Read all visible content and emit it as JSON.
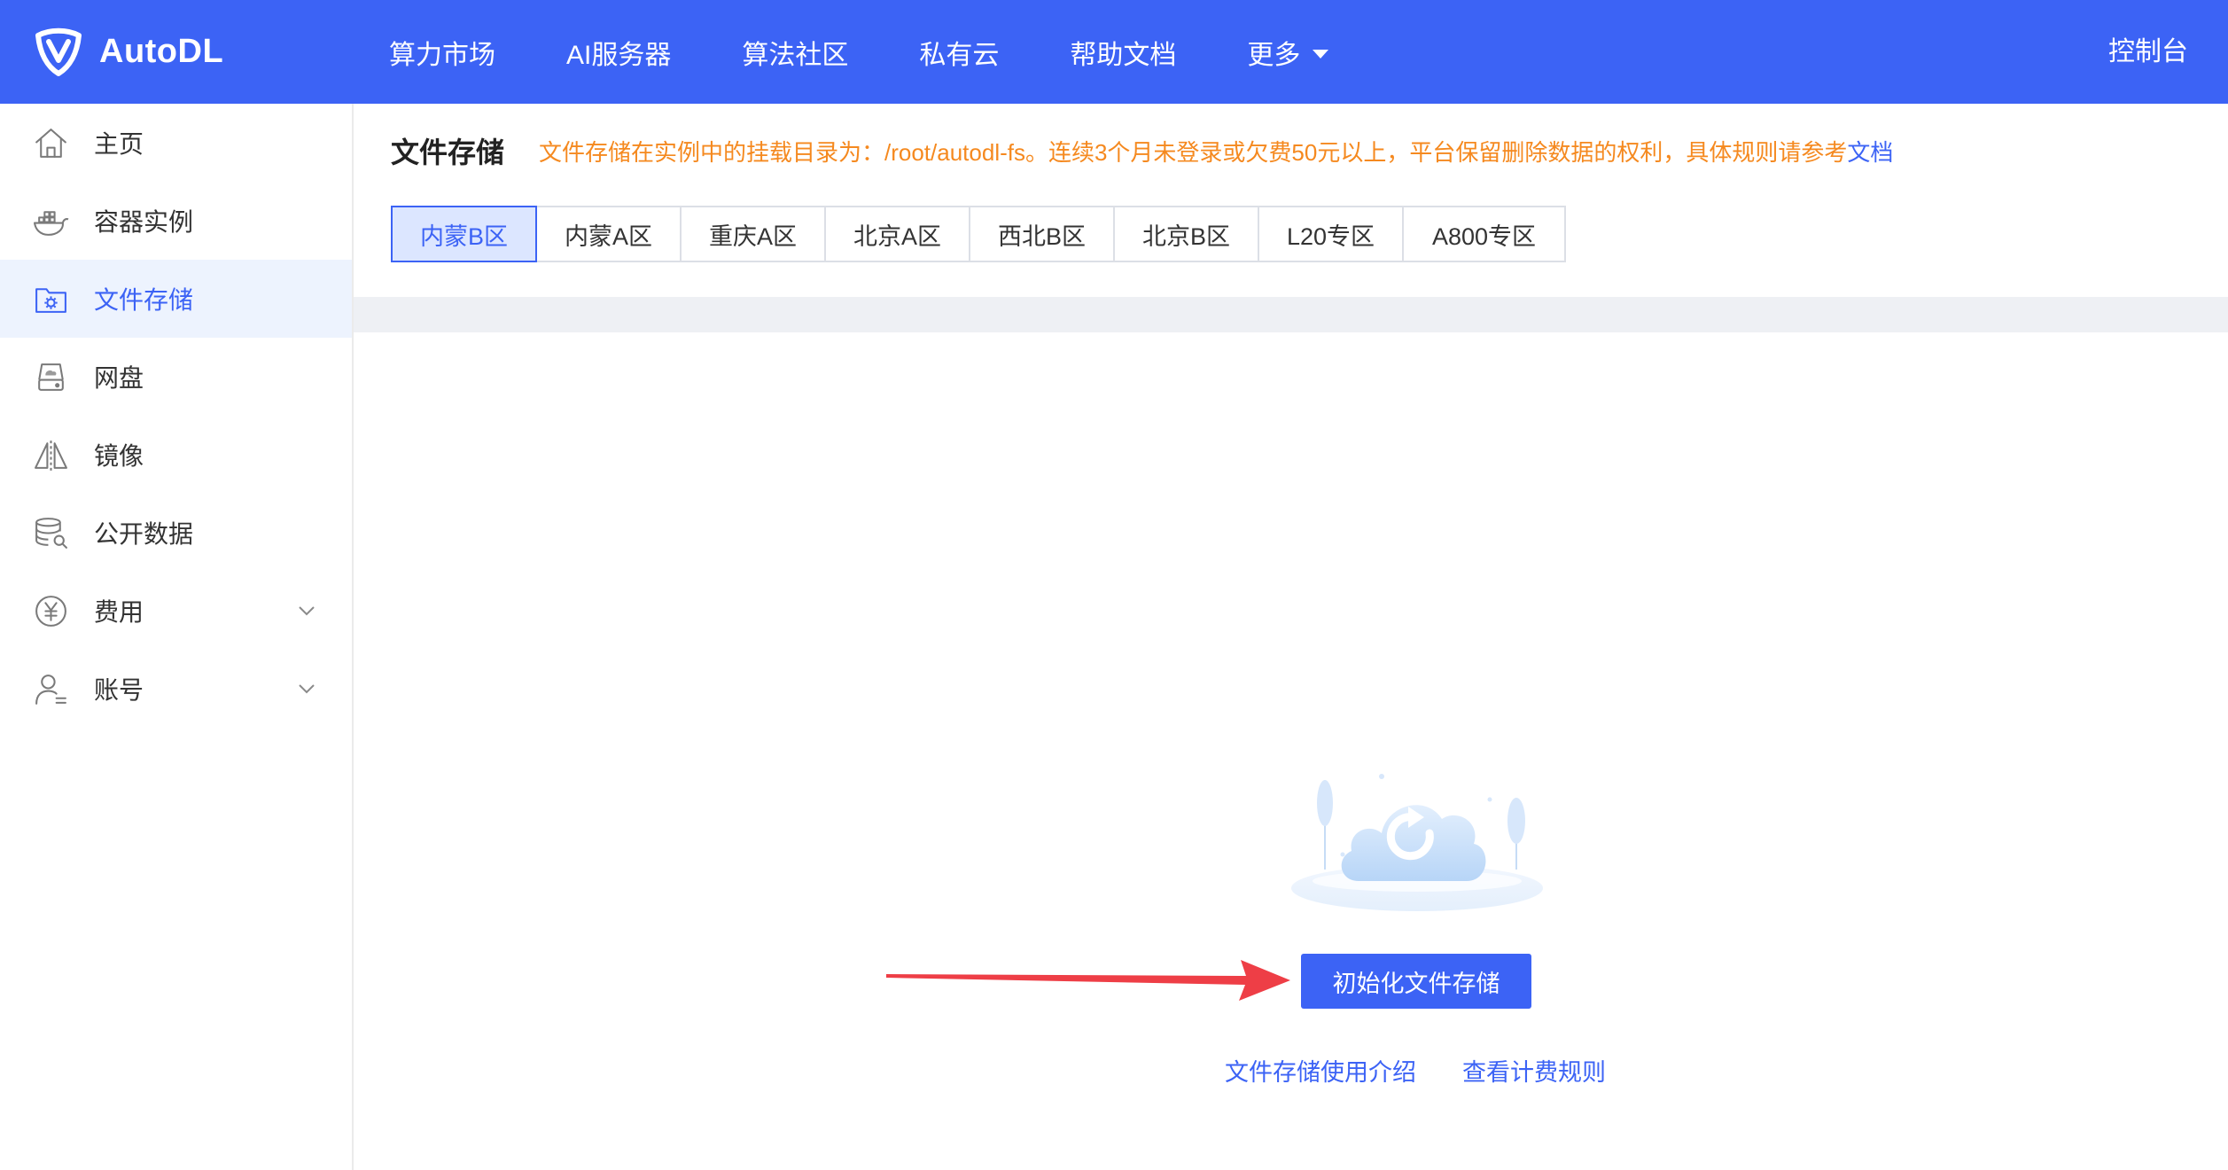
{
  "header": {
    "brand": "AutoDL",
    "logo_icon": "autodl-logo-icon",
    "nav": [
      {
        "label": "算力市场"
      },
      {
        "label": "AI服务器"
      },
      {
        "label": "算法社区"
      },
      {
        "label": "私有云"
      },
      {
        "label": "帮助文档"
      },
      {
        "label": "更多",
        "icon": "caret-down-icon"
      }
    ],
    "console": "控制台"
  },
  "sidebar": {
    "items": [
      {
        "label": "主页",
        "icon": "home-icon",
        "active": false
      },
      {
        "label": "容器实例",
        "icon": "docker-icon",
        "active": false
      },
      {
        "label": "文件存储",
        "icon": "folder-gear-icon",
        "active": true
      },
      {
        "label": "网盘",
        "icon": "disk-icon",
        "active": false
      },
      {
        "label": "镜像",
        "icon": "mirror-icon",
        "active": false
      },
      {
        "label": "公开数据",
        "icon": "database-search-icon",
        "active": false
      },
      {
        "label": "费用",
        "icon": "yen-icon",
        "active": false,
        "expandable": true
      },
      {
        "label": "账号",
        "icon": "user-icon",
        "active": false,
        "expandable": true
      }
    ]
  },
  "main": {
    "title": "文件存储",
    "notice": "文件存储在实例中的挂载目录为：/root/autodl-fs。连续3个月未登录或欠费50元以上，平台保留删除数据的权利，具体规则请参考",
    "notice_link": "文档",
    "regions": [
      {
        "label": "内蒙B区",
        "active": true
      },
      {
        "label": "内蒙A区",
        "active": false
      },
      {
        "label": "重庆A区",
        "active": false
      },
      {
        "label": "北京A区",
        "active": false
      },
      {
        "label": "西北B区",
        "active": false
      },
      {
        "label": "北京B区",
        "active": false
      },
      {
        "label": "L20专区",
        "active": false
      },
      {
        "label": "A800专区",
        "active": false
      }
    ],
    "empty_state": {
      "illustration": "cloud-refresh-icon",
      "init_button": "初始化文件存储",
      "intro_link": "文件存储使用介绍",
      "pricing_link": "查看计费规则"
    }
  },
  "colors": {
    "primary": "#3c63f5",
    "notice": "#f5891f",
    "active_bg": "#edf3fe",
    "band": "#eef0f4",
    "annotation_arrow": "#ee3e46"
  }
}
